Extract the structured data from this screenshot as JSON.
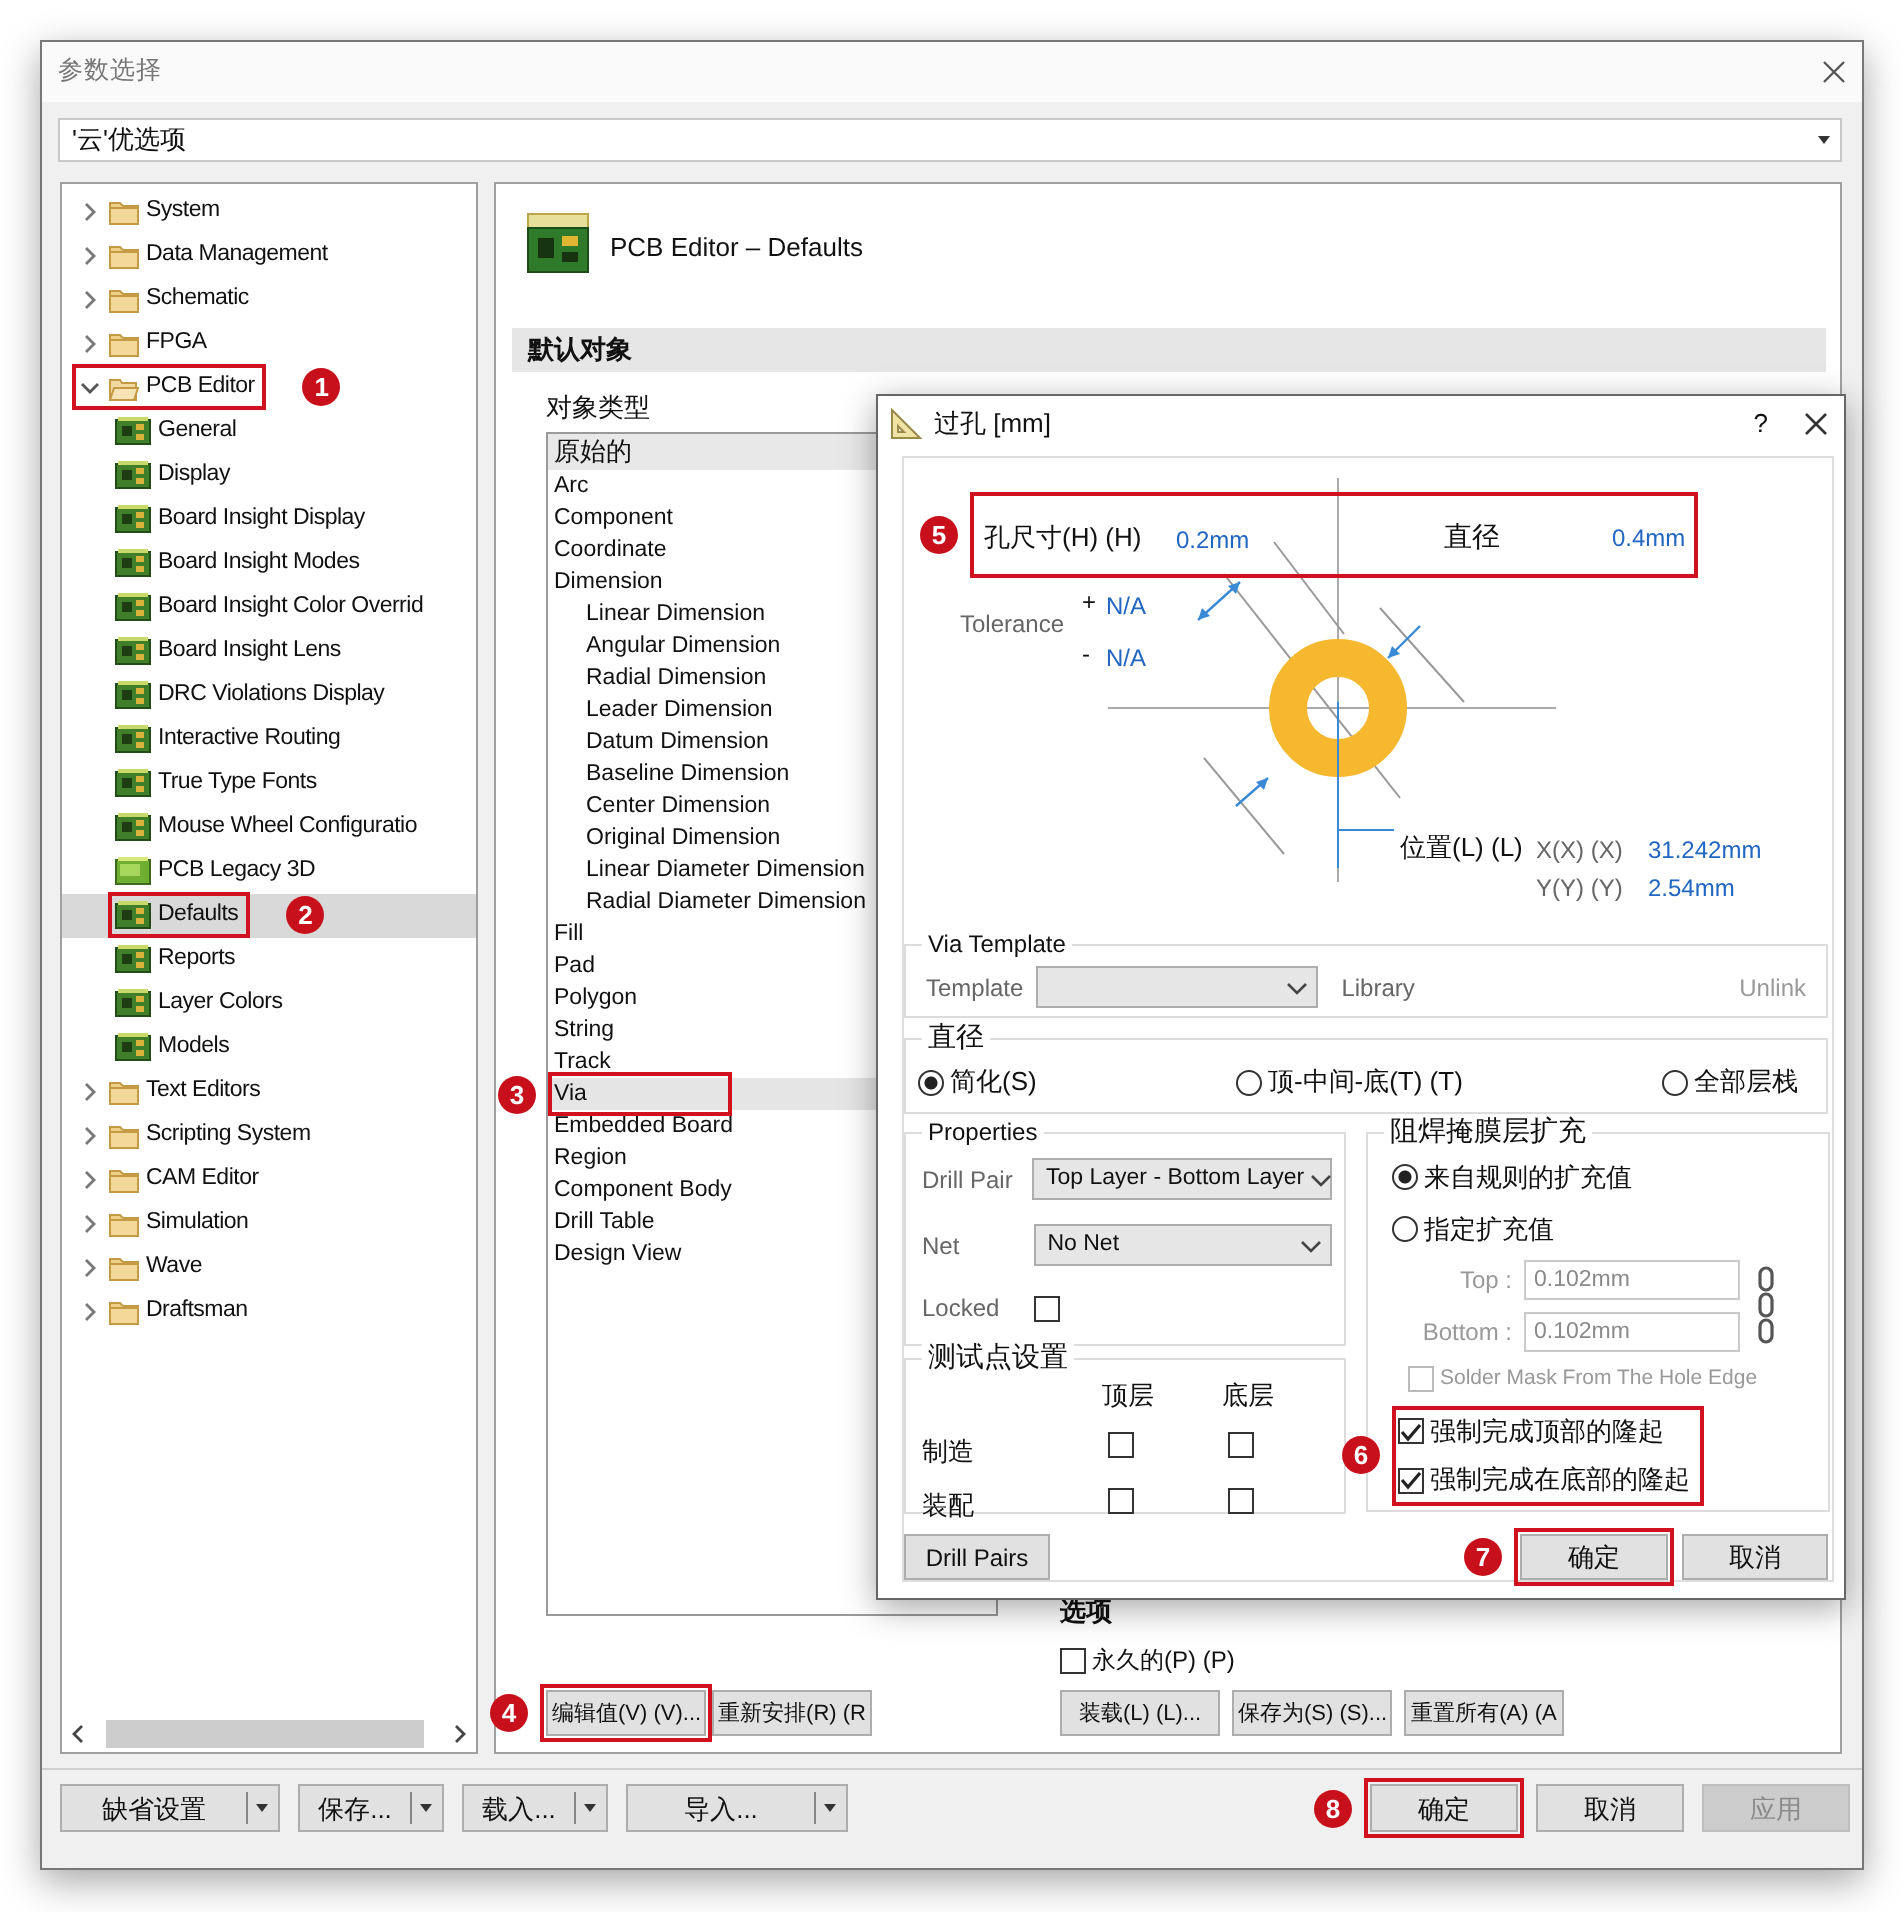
{
  "window": {
    "title": "参数选择"
  },
  "preset": {
    "value": "'云'优选项"
  },
  "tree": [
    {
      "label": "System",
      "kind": "folder",
      "expanded": false,
      "selected": false
    },
    {
      "label": "Data Management",
      "kind": "folder",
      "expanded": false,
      "selected": false
    },
    {
      "label": "Schematic",
      "kind": "folder",
      "expanded": false,
      "selected": false
    },
    {
      "label": "FPGA",
      "kind": "folder",
      "expanded": false,
      "selected": false
    },
    {
      "label": "PCB Editor",
      "kind": "folder",
      "expanded": true,
      "selected": false,
      "step": "1",
      "children": [
        {
          "label": "General",
          "kind": "page",
          "selected": false
        },
        {
          "label": "Display",
          "kind": "page",
          "selected": false
        },
        {
          "label": "Board Insight Display",
          "kind": "page",
          "selected": false
        },
        {
          "label": "Board Insight Modes",
          "kind": "page",
          "selected": false
        },
        {
          "label": "Board Insight Color Overrid",
          "kind": "page",
          "selected": false
        },
        {
          "label": "Board Insight Lens",
          "kind": "page",
          "selected": false
        },
        {
          "label": "DRC Violations Display",
          "kind": "page",
          "selected": false
        },
        {
          "label": "Interactive Routing",
          "kind": "page",
          "selected": false
        },
        {
          "label": "True Type Fonts",
          "kind": "page",
          "selected": false
        },
        {
          "label": "Mouse Wheel Configuratio",
          "kind": "page",
          "selected": false
        },
        {
          "label": "PCB Legacy 3D",
          "kind": "page3d",
          "selected": false
        },
        {
          "label": "Defaults",
          "kind": "page",
          "selected": true,
          "step": "2"
        },
        {
          "label": "Reports",
          "kind": "page",
          "selected": false
        },
        {
          "label": "Layer Colors",
          "kind": "page",
          "selected": false
        },
        {
          "label": "Models",
          "kind": "page",
          "selected": false
        }
      ]
    },
    {
      "label": "Text Editors",
      "kind": "folder",
      "expanded": false,
      "selected": false
    },
    {
      "label": "Scripting System",
      "kind": "folder",
      "expanded": false,
      "selected": false
    },
    {
      "label": "CAM Editor",
      "kind": "folder",
      "expanded": false,
      "selected": false
    },
    {
      "label": "Simulation",
      "kind": "folder",
      "expanded": false,
      "selected": false
    },
    {
      "label": "Wave",
      "kind": "folder",
      "expanded": false,
      "selected": false
    },
    {
      "label": "Draftsman",
      "kind": "folder",
      "expanded": false,
      "selected": false
    }
  ],
  "panel": {
    "title": "PCB Editor – Defaults",
    "section": "默认对象",
    "list_label": "对象类型",
    "list_header": "原始的",
    "object_types": [
      {
        "label": "Arc",
        "selected": false
      },
      {
        "label": "Component",
        "selected": false
      },
      {
        "label": "Coordinate",
        "selected": false
      },
      {
        "label": "Dimension",
        "selected": false,
        "children": [
          {
            "label": "Linear Dimension",
            "selected": false
          },
          {
            "label": "Angular Dimension",
            "selected": false
          },
          {
            "label": "Radial Dimension",
            "selected": false
          },
          {
            "label": "Leader Dimension",
            "selected": false
          },
          {
            "label": "Datum Dimension",
            "selected": false
          },
          {
            "label": "Baseline Dimension",
            "selected": false
          },
          {
            "label": "Center Dimension",
            "selected": false
          },
          {
            "label": "Original Dimension",
            "selected": false
          },
          {
            "label": "Linear Diameter Dimension",
            "selected": false
          },
          {
            "label": "Radial Diameter Dimension",
            "selected": false
          }
        ]
      },
      {
        "label": "Fill",
        "selected": false
      },
      {
        "label": "Pad",
        "selected": false
      },
      {
        "label": "Polygon",
        "selected": false
      },
      {
        "label": "String",
        "selected": false
      },
      {
        "label": "Track",
        "selected": false
      },
      {
        "label": "Via",
        "selected": true,
        "step": "3"
      },
      {
        "label": "Embedded Board",
        "selected": false
      },
      {
        "label": "Region",
        "selected": false
      },
      {
        "label": "Component Body",
        "selected": false
      },
      {
        "label": "Drill Table",
        "selected": false
      },
      {
        "label": "Design View",
        "selected": false
      }
    ],
    "list_buttons": [
      {
        "label": "编辑值(V) (V)...",
        "step": "4"
      },
      {
        "label": "重新安排(R) (R"
      }
    ],
    "options_title": "选项",
    "permanent": {
      "label": "永久的(P) (P)",
      "checked": false
    },
    "option_buttons": [
      "装载(L) (L)...",
      "保存为(S) (S)...",
      "重置所有(A) (A"
    ]
  },
  "footer": {
    "split_buttons": [
      "缺省设置",
      "保存...",
      "载入...",
      "导入..."
    ],
    "buttons": [
      {
        "label": "确定",
        "disabled": false,
        "step": "8"
      },
      {
        "label": "取消",
        "disabled": false
      },
      {
        "label": "应用",
        "disabled": true
      }
    ]
  },
  "via_dialog": {
    "title": "过孔 [mm]",
    "help": "?",
    "diagram": {
      "hole_size_label": "孔尺寸(H) (H)",
      "hole_size": "0.2mm",
      "diameter_label": "直径",
      "diameter": "0.4mm",
      "step": "5",
      "tolerance_label": "Tolerance",
      "tolerances": [
        {
          "sign": "+",
          "value": "N/A"
        },
        {
          "sign": "-",
          "value": "N/A"
        }
      ],
      "location_label": "位置(L) (L)",
      "x_label": "X(X) (X)",
      "x": "31.242mm",
      "y_label": "Y(Y) (Y)",
      "y": "2.54mm"
    },
    "via_template": {
      "title": "Via Template",
      "template_label": "Template",
      "library": "Library",
      "unlink": "Unlink"
    },
    "diameter_mode": {
      "title": "直径",
      "options": [
        {
          "label": "简化(S)",
          "selected": true
        },
        {
          "label": "顶-中间-底(T) (T)",
          "selected": false
        },
        {
          "label": "全部层栈",
          "selected": false
        }
      ]
    },
    "properties": {
      "title": "Properties",
      "drill_pair_label": "Drill Pair",
      "drill_pair": "Top Layer - Bottom Layer",
      "net_label": "Net",
      "net": "No Net",
      "locked_label": "Locked",
      "locked": false
    },
    "testpoints": {
      "title": "测试点设置",
      "columns": [
        "顶层",
        "底层"
      ],
      "rows": [
        {
          "label": "制造",
          "top": false,
          "bottom": false
        },
        {
          "label": "装配",
          "top": false,
          "bottom": false
        }
      ]
    },
    "solder_mask": {
      "title": "阻焊掩膜层扩充",
      "modes": [
        {
          "label": "来自规则的扩充值",
          "selected": true
        },
        {
          "label": "指定扩充值",
          "selected": false
        }
      ],
      "top_label": "Top :",
      "top": "0.102mm",
      "bottom_label": "Bottom :",
      "bottom": "0.102mm",
      "fields_disabled": true,
      "hole_edge": {
        "label": "Solder Mask From The Hole Edge",
        "checked": false,
        "disabled": true
      },
      "tenting_step": "6",
      "tenting": [
        {
          "label": "强制完成顶部的隆起",
          "checked": true
        },
        {
          "label": "强制完成在底部的隆起",
          "checked": true
        }
      ]
    },
    "drill_pairs": "Drill Pairs",
    "ok": {
      "label": "确定",
      "step": "7"
    },
    "cancel": "取消"
  }
}
